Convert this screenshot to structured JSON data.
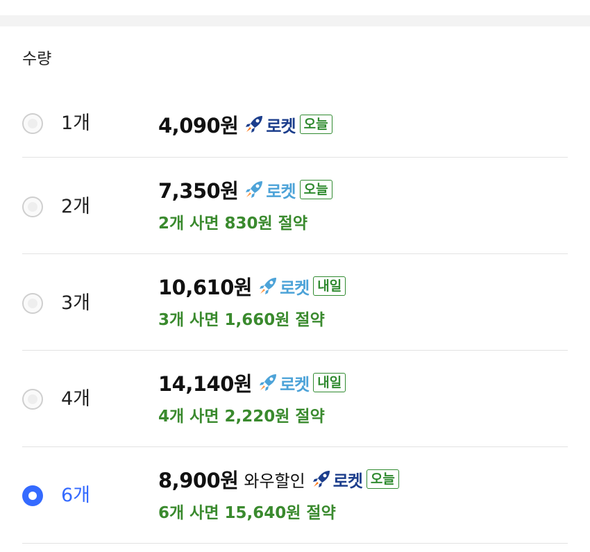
{
  "section": {
    "title": "수량"
  },
  "colors": {
    "accent": "#346aff",
    "saving_green": "#3a8a2e",
    "badge_green": "#2f8a2f"
  },
  "options": [
    {
      "qty": "1개",
      "price": "4,090원",
      "discount_label": "",
      "rocket_label": "로켓",
      "badge": "오늘",
      "saving": "",
      "selected": false
    },
    {
      "qty": "2개",
      "price": "7,350원",
      "discount_label": "",
      "rocket_label": "로켓",
      "badge": "오늘",
      "saving": "2개 사면 830원 절약",
      "selected": false
    },
    {
      "qty": "3개",
      "price": "10,610원",
      "discount_label": "",
      "rocket_label": "로켓",
      "badge": "내일",
      "saving": "3개 사면 1,660원 절약",
      "selected": false
    },
    {
      "qty": "4개",
      "price": "14,140원",
      "discount_label": "",
      "rocket_label": "로켓",
      "badge": "내일",
      "saving": "4개 사면 2,220원 절약",
      "selected": false
    },
    {
      "qty": "6개",
      "price": "8,900원",
      "discount_label": "와우할인",
      "rocket_label": "로켓",
      "badge": "오늘",
      "saving": "6개 사면 15,640원 절약",
      "selected": true
    }
  ],
  "icons": {
    "rocket": "rocket-icon",
    "radio": "radio-icon"
  }
}
